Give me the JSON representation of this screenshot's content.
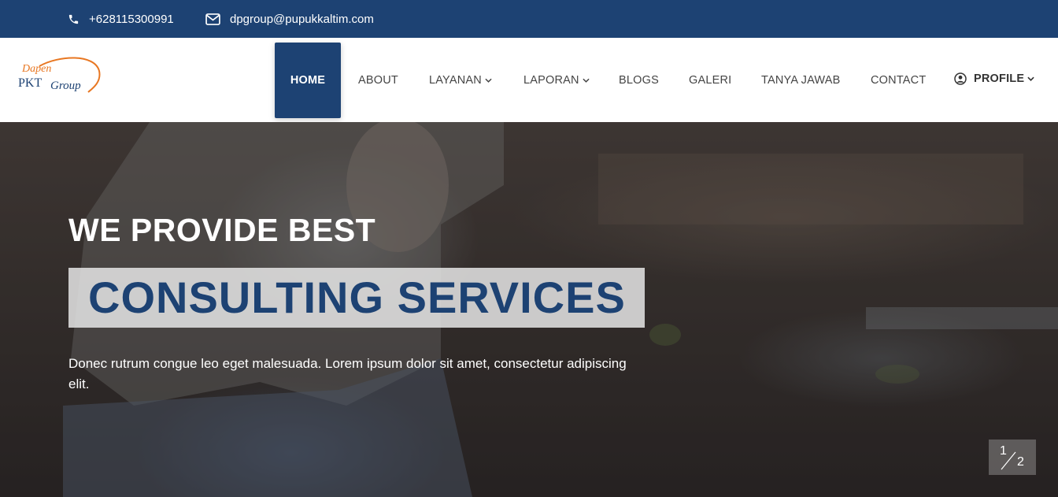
{
  "topbar": {
    "phone": "+628115300991",
    "email": "dpgroup@pupukkaltim.com",
    "icons": [
      "phone-icon",
      "envelope-icon"
    ]
  },
  "logo": {
    "line1": "Dapen",
    "line2": "PKT",
    "line3": "Group"
  },
  "nav": {
    "home": "HOME",
    "about": "ABOUT",
    "layanan": "LAYANAN",
    "laporan": "LAPORAN",
    "blogs": "BLOGS",
    "galeri": "GALERI",
    "tanya_jawab": "TANYA JAWAB",
    "contact": "CONTACT",
    "profile": "PROFILE"
  },
  "hero": {
    "small_title": "WE PROVIDE BEST",
    "big_title": "CONSULTING SERVICES",
    "description": "Donec rutrum congue leo eget malesuada. Lorem ipsum dolor sit amet, consectetur adipiscing elit."
  },
  "slider": {
    "current": "1",
    "total": "2"
  },
  "colors": {
    "primary": "#1d4273",
    "accent": "#e87722"
  }
}
